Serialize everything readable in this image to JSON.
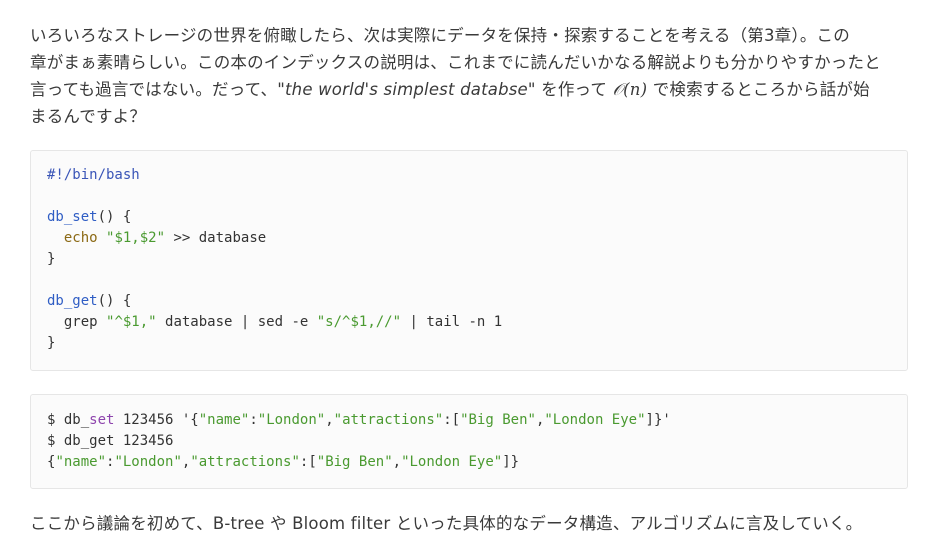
{
  "intro": {
    "line1": "いろいろなストレージの世界を俯瞰したら、次は実際にデータを保持・探索することを考える（第3章）。この",
    "line2": "章がまぁ素晴らしい。この本のインデックスの説明は、これまでに読んだいかなる解説よりも分かりやすかったと",
    "line3_prefix": "言っても過言ではない。だって、",
    "line3_quote": "\"the world's simplest databse\"",
    "line3_mid": " を作って ",
    "line3_math": "𝒪(n)",
    "line3_suffix": " で検索するところから話が始",
    "line4": "まるんですよ？"
  },
  "code_block_1": {
    "shebang": "#!/bin/bash",
    "set_name": "db_set",
    "set_open": "() {",
    "echo_cmd": "echo",
    "echo_arg": "\"$1,$2\"",
    "echo_rest": " >> database",
    "close1": "}",
    "get_name": "db_get",
    "get_open": "() {",
    "grep_cmd": "grep ",
    "grep_arg": "\"^$1,\"",
    "grep_mid": " database | sed -e ",
    "sed_arg": "\"s/^$1,//\"",
    "grep_rest": " | tail -n 1",
    "close2": "}"
  },
  "code_block_2": {
    "l1_prompt": "$ db_",
    "l1_set": "set",
    "l1_args": " 123456 '{",
    "l1_k1": "\"name\"",
    "l1_c1": ":",
    "l1_v1": "\"London\"",
    "l1_c2": ",",
    "l1_k2": "\"attractions\"",
    "l1_c3": ":[",
    "l1_v2": "\"Big Ben\"",
    "l1_c4": ",",
    "l1_v3": "\"London Eye\"",
    "l1_end": "]}'",
    "l2": "$ db_get 123456",
    "l3_open": "{",
    "l3_k1": "\"name\"",
    "l3_c1": ":",
    "l3_v1": "\"London\"",
    "l3_c2": ",",
    "l3_k2": "\"attractions\"",
    "l3_c3": ":[",
    "l3_v2": "\"Big Ben\"",
    "l3_c4": ",",
    "l3_v3": "\"London Eye\"",
    "l3_end": "]}"
  },
  "outro": {
    "text": "ここから議論を初めて、B-tree や Bloom filter といった具体的なデータ構造、アルゴリズムに言及していく。"
  },
  "colors": {
    "keyword": "#3a55b7",
    "string": "#4a9a30",
    "builtin": "#8b6914",
    "code_background": "#fbfbfb"
  }
}
